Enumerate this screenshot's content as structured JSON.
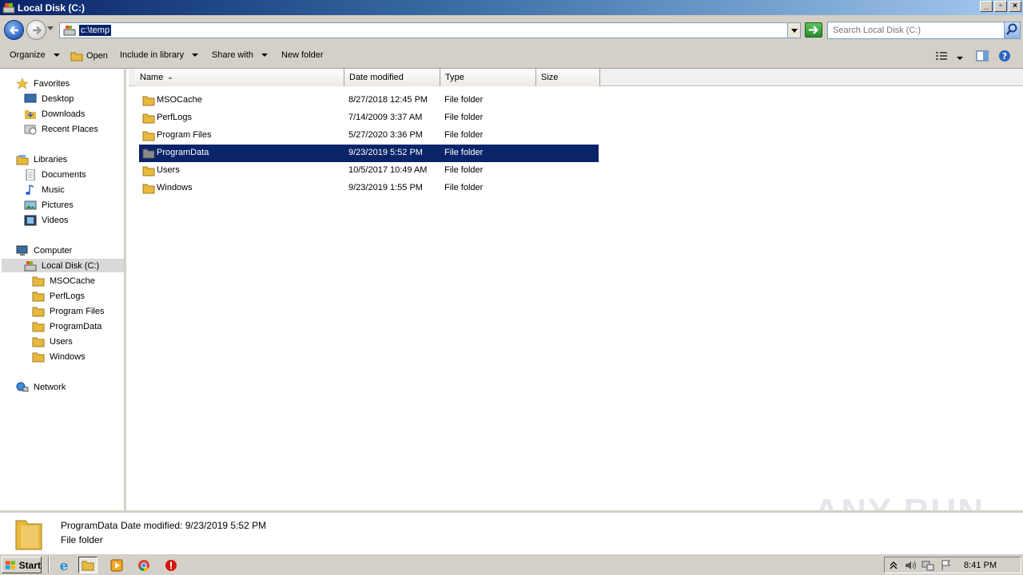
{
  "window": {
    "title": "Local Disk (C:)",
    "buttons": [
      "minimize",
      "restore",
      "close"
    ]
  },
  "address_bar": {
    "value": "c:\\temp",
    "search_placeholder": "Search Local Disk (C:)"
  },
  "toolbar": {
    "organize": "Organize",
    "open": "Open",
    "include_in_library": "Include in library",
    "share_with": "Share with",
    "new_folder": "New folder"
  },
  "nav": {
    "favorites": "Favorites",
    "desktop": "Desktop",
    "downloads": "Downloads",
    "recent_places": "Recent Places",
    "libraries": "Libraries",
    "documents": "Documents",
    "music": "Music",
    "pictures": "Pictures",
    "videos": "Videos",
    "computer": "Computer",
    "local_disk": "Local Disk (C:)",
    "children": [
      "MSOCache",
      "PerfLogs",
      "Program Files",
      "ProgramData",
      "Users",
      "Windows"
    ],
    "network": "Network"
  },
  "columns": {
    "name": "Name",
    "date": "Date modified",
    "type": "Type",
    "size": "Size"
  },
  "files": [
    {
      "name": "MSOCache",
      "date": "8/27/2018 12:45 PM",
      "type": "File folder"
    },
    {
      "name": "PerfLogs",
      "date": "7/14/2009 3:37 AM",
      "type": "File folder"
    },
    {
      "name": "Program Files",
      "date": "5/27/2020 3:36 PM",
      "type": "File folder"
    },
    {
      "name": "ProgramData",
      "date": "9/23/2019 5:52 PM",
      "type": "File folder",
      "selected": true
    },
    {
      "name": "Users",
      "date": "10/5/2017 10:49 AM",
      "type": "File folder"
    },
    {
      "name": "Windows",
      "date": "9/23/2019 1:55 PM",
      "type": "File folder"
    }
  ],
  "details": {
    "name": "ProgramData",
    "date_label": "Date modified: 9/23/2019 5:52 PM",
    "type": "File folder"
  },
  "watermark": "ANY RUN",
  "taskbar": {
    "start": "Start",
    "clock": "8:41 PM"
  },
  "colors": {
    "selection": "#0a246a",
    "chrome": "#d4d0c8",
    "folder": "#e8b93c"
  }
}
